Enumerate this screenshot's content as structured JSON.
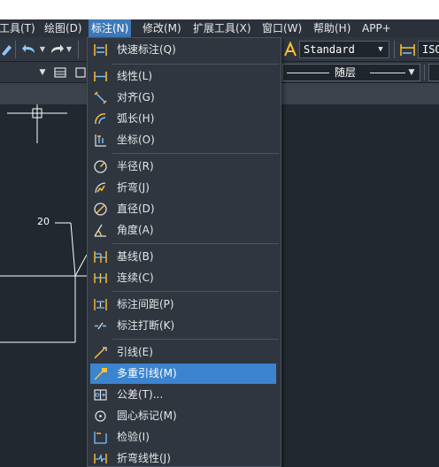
{
  "menubar": {
    "items": [
      {
        "label": "工具(T)"
      },
      {
        "label": "绘图(D)"
      },
      {
        "label": "标注(N)"
      },
      {
        "label": "修改(M)"
      },
      {
        "label": "扩展工具(X)"
      },
      {
        "label": "窗口(W)"
      },
      {
        "label": "帮助(H)"
      },
      {
        "label": "APP+"
      }
    ]
  },
  "toolbar": {
    "text_style": "Standard",
    "dim_style": "ISO-",
    "layer": "随层"
  },
  "drawing": {
    "dimension_text": "20"
  },
  "dimension_menu": {
    "items": [
      {
        "label": "快速标注(Q)",
        "icon": "quick-dimension-icon"
      },
      {
        "label": "线性(L)",
        "icon": "linear-dimension-icon"
      },
      {
        "label": "对齐(G)",
        "icon": "aligned-dimension-icon"
      },
      {
        "label": "弧长(H)",
        "icon": "arc-length-icon"
      },
      {
        "label": "坐标(O)",
        "icon": "ordinate-icon"
      },
      {
        "label": "半径(R)",
        "icon": "radius-icon"
      },
      {
        "label": "折弯(J)",
        "icon": "jogged-radius-icon"
      },
      {
        "label": "直径(D)",
        "icon": "diameter-icon"
      },
      {
        "label": "角度(A)",
        "icon": "angular-icon"
      },
      {
        "label": "基线(B)",
        "icon": "baseline-icon"
      },
      {
        "label": "连续(C)",
        "icon": "continue-icon"
      },
      {
        "label": "标注间距(P)",
        "icon": "dimension-space-icon"
      },
      {
        "label": "标注打断(K)",
        "icon": "dimension-break-icon"
      },
      {
        "label": "引线(E)",
        "icon": "leader-icon"
      },
      {
        "label": "多重引线(M)",
        "icon": "multileader-icon"
      },
      {
        "label": "公差(T)...",
        "icon": "tolerance-icon"
      },
      {
        "label": "圆心标记(M)",
        "icon": "center-mark-icon"
      },
      {
        "label": "检验(I)",
        "icon": "inspection-icon"
      },
      {
        "label": "折弯线性(J)",
        "icon": "jogged-linear-icon"
      }
    ],
    "selected_index": 14
  },
  "colors": {
    "menu_active": "#3e79b8",
    "item_selected": "#3c84cf",
    "icon_accent": "#ffc233",
    "icon_blue": "#7ec3ff"
  }
}
